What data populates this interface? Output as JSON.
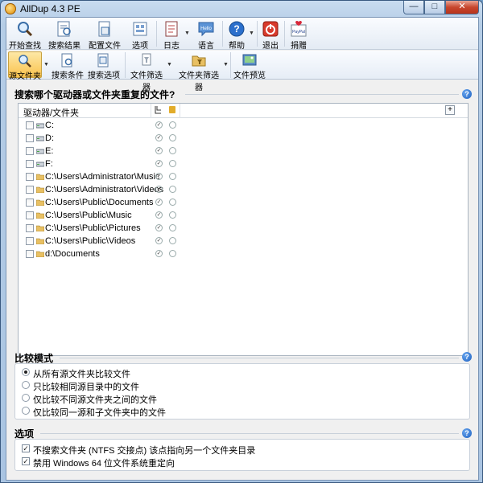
{
  "window": {
    "title": "AllDup 4.3 PE"
  },
  "toolbar": {
    "buttons": [
      {
        "label": "开始查找",
        "icon": "magnifier-icon"
      },
      {
        "label": "搜索结果",
        "icon": "results-icon"
      },
      {
        "label": "配置文件",
        "icon": "profile-icon"
      },
      {
        "label": "选项",
        "icon": "options-icon"
      },
      {
        "label": "日志",
        "icon": "log-icon"
      },
      {
        "label": "语言",
        "icon": "language-icon"
      },
      {
        "label": "帮助",
        "icon": "help-icon"
      },
      {
        "label": "退出",
        "icon": "exit-icon"
      },
      {
        "label": "捐赠",
        "icon": "donate-icon"
      }
    ]
  },
  "tabs": [
    {
      "label": "源文件夹",
      "active": true
    },
    {
      "label": "搜索条件"
    },
    {
      "label": "搜索选项"
    },
    {
      "label": "文件筛选器"
    },
    {
      "label": "文件夹筛选器"
    },
    {
      "label": "文件预览"
    }
  ],
  "folders_section": {
    "title": "搜索哪个驱动器或文件夹重复的文件?",
    "column_header": "驱动器/文件夹",
    "items": [
      {
        "label": "C:",
        "type": "drive"
      },
      {
        "label": "D:",
        "type": "drive"
      },
      {
        "label": "E:",
        "type": "drive"
      },
      {
        "label": "F:",
        "type": "drive"
      },
      {
        "label": "C:\\Users\\Administrator\\Music",
        "type": "folder"
      },
      {
        "label": "C:\\Users\\Administrator\\Videos",
        "type": "folder"
      },
      {
        "label": "C:\\Users\\Public\\Documents",
        "type": "folder"
      },
      {
        "label": "C:\\Users\\Public\\Music",
        "type": "folder"
      },
      {
        "label": "C:\\Users\\Public\\Pictures",
        "type": "folder"
      },
      {
        "label": "C:\\Users\\Public\\Videos",
        "type": "folder"
      },
      {
        "label": "d:\\Documents",
        "type": "folder"
      }
    ]
  },
  "compare_section": {
    "title": "比较模式",
    "options": [
      {
        "label": "从所有源文件夹比较文件",
        "selected": true
      },
      {
        "label": "只比较相同源目录中的文件",
        "selected": false
      },
      {
        "label": "仅比较不同源文件夹之间的文件",
        "selected": false
      },
      {
        "label": "仅比较同一源和子文件夹中的文件",
        "selected": false
      }
    ]
  },
  "options_section": {
    "title": "选项",
    "items": [
      {
        "label": "不搜索文件夹 (NTFS 交接点) 该点指向另一个文件夹目录",
        "checked": true
      },
      {
        "label": "禁用 Windows 64 位文件系统重定向",
        "checked": true
      }
    ]
  },
  "colors": {
    "accent": "#1b5fbf",
    "active_tab": "#fac24c"
  }
}
